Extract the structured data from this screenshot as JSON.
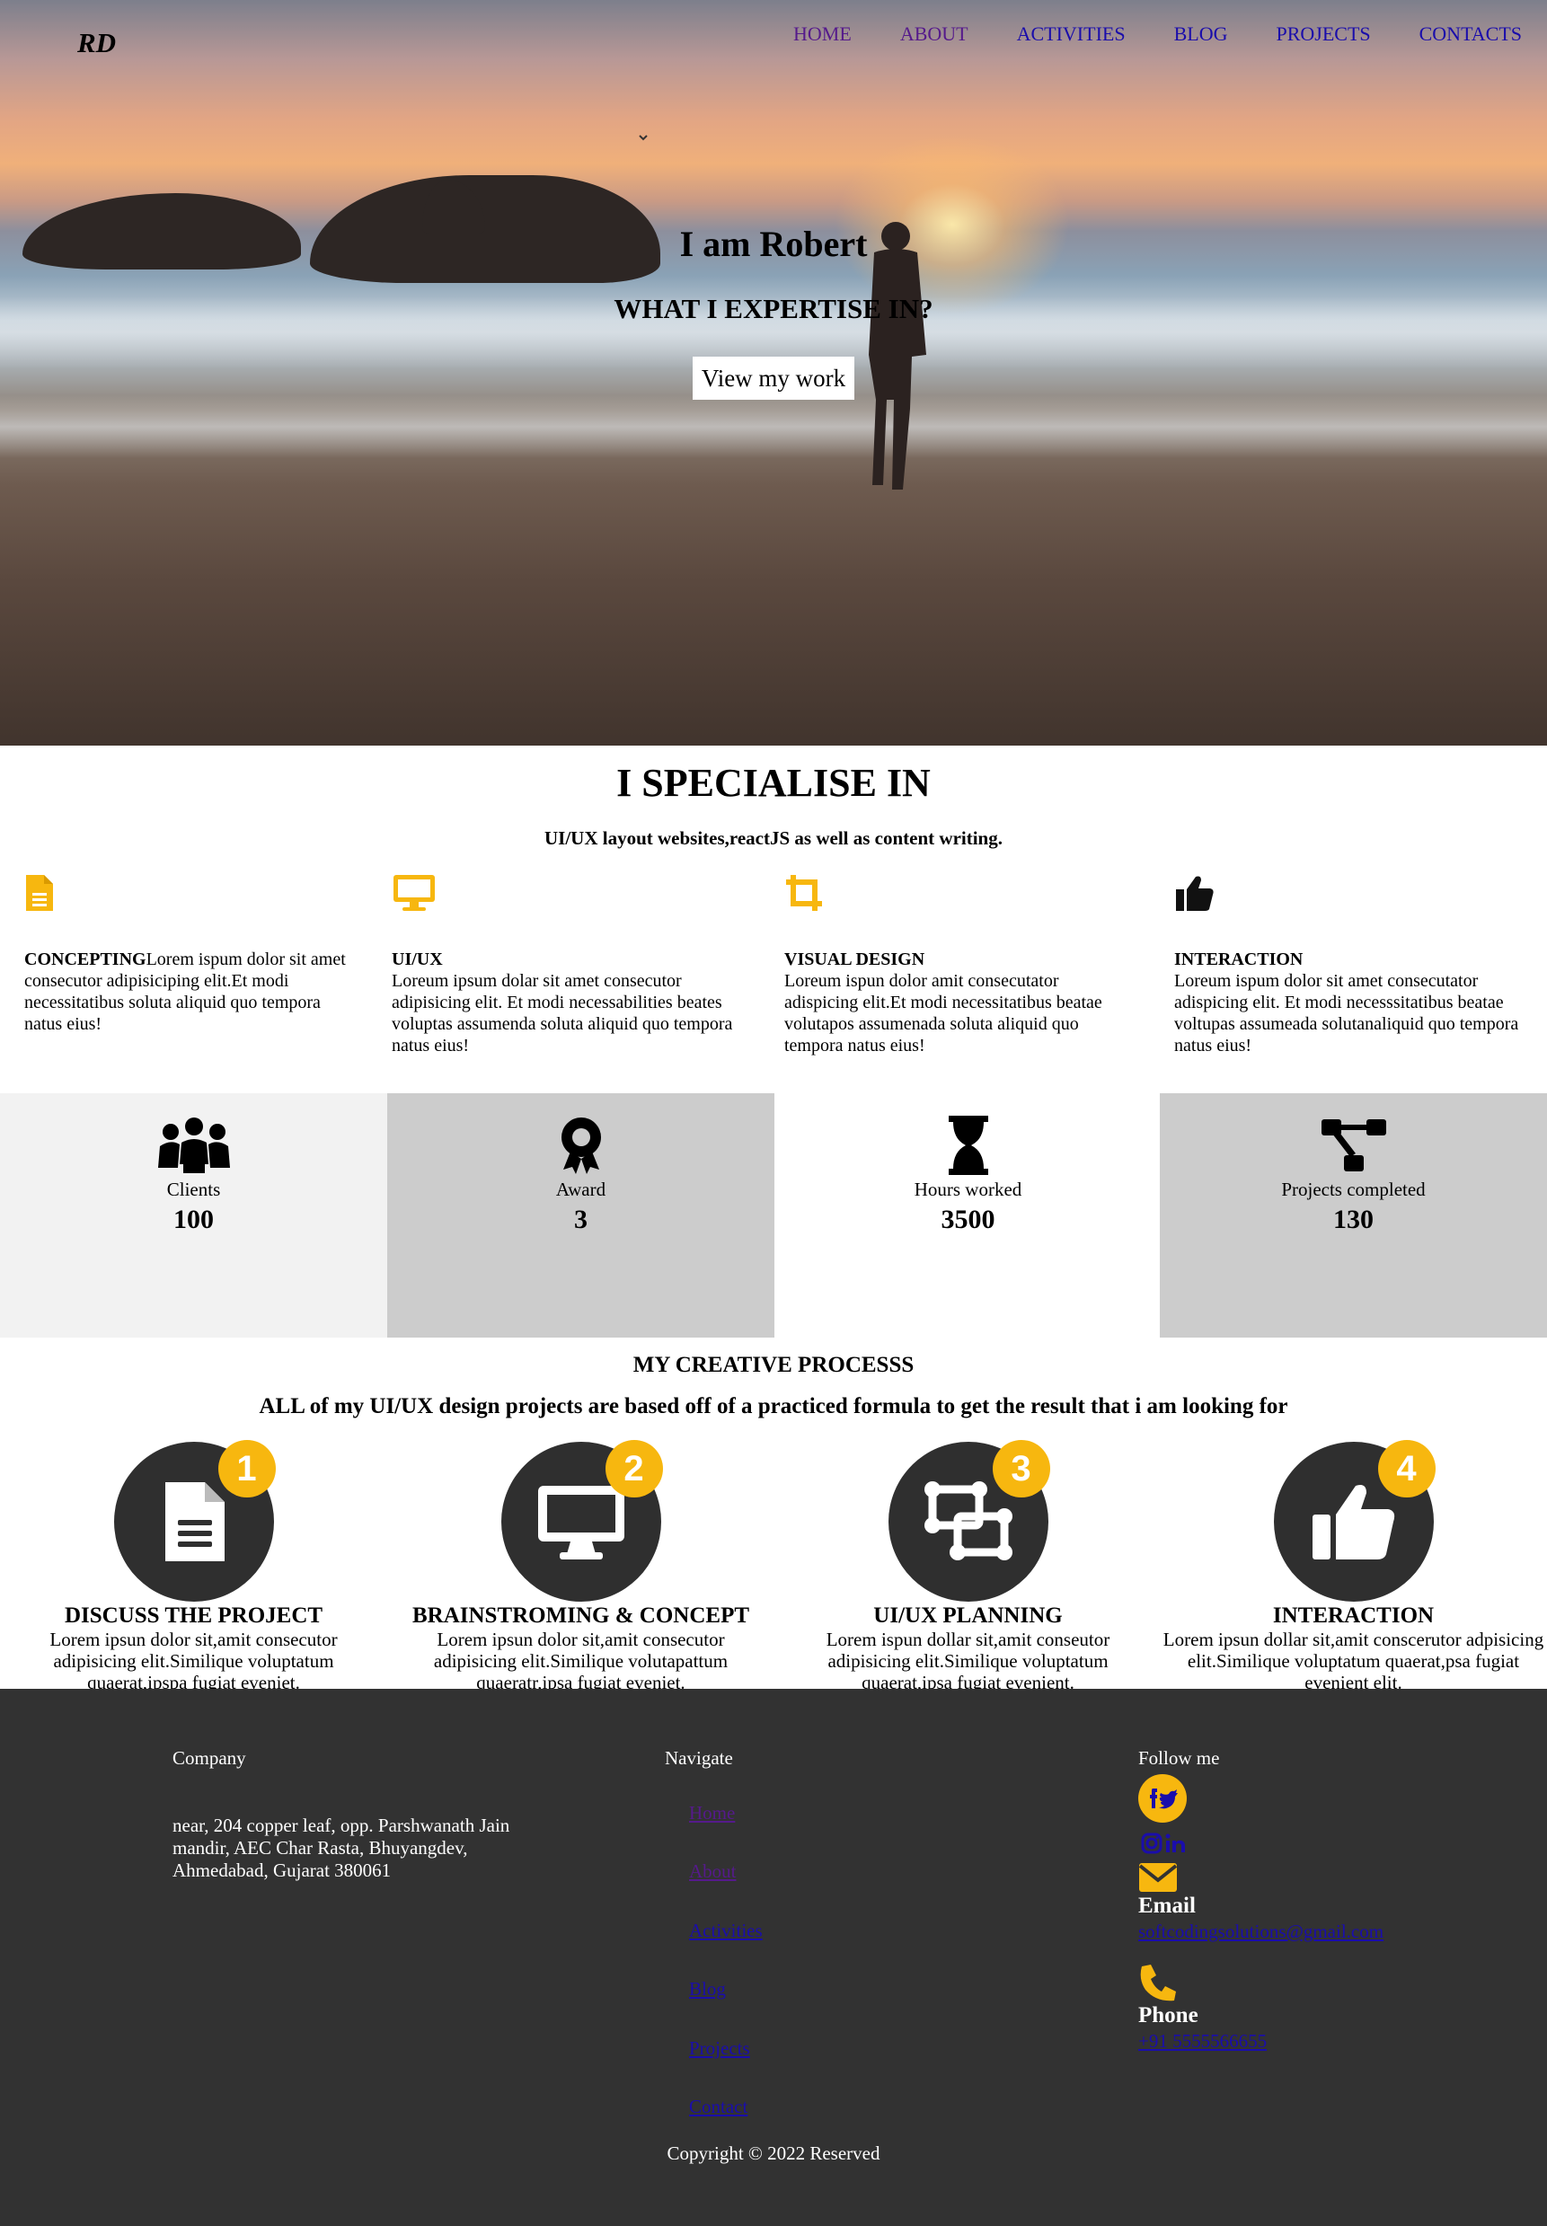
{
  "header": {
    "logo": "RD",
    "nav": [
      {
        "label": "HOME",
        "visited": true
      },
      {
        "label": "ABOUT",
        "visited": true
      },
      {
        "label": "ACTIVITIES",
        "visited": false
      },
      {
        "label": "BLOG",
        "visited": false
      },
      {
        "label": "PROJECTS",
        "visited": false
      },
      {
        "label": "CONTACTS",
        "visited": false
      }
    ]
  },
  "hero": {
    "title": "I am Robert",
    "subtitle": "WHAT I EXPERTISE IN?",
    "button": "View my work"
  },
  "specialise": {
    "title": "I SPECIALISE IN",
    "subtitle": "UI/UX layout websites,reactJS as well as content writing.",
    "items": [
      {
        "icon": "document-icon",
        "title": "CONCEPTING",
        "text": "Lorem ispum dolor sit amet consecutor adipisiciping elit.Et modi necessitatibus soluta aliquid quo tempora natus eius!"
      },
      {
        "icon": "monitor-icon",
        "title": "UI/UX",
        "text": "Loreum ipsum dolar sit amet consecutor adipisicing elit. Et modi necessabilities beates voluptas assumenda soluta aliquid quo tempora natus eius!"
      },
      {
        "icon": "crop-icon",
        "title": "VISUAL DESIGN",
        "text": "Loreum ispun dolor amit consecutator adispicing elit.Et modi necessitatibus beatae volutapos assumenada soluta aliquid quo tempora natus eius!"
      },
      {
        "icon": "thumbs-up-icon",
        "title": "INTERACTION",
        "text": "Loreum ispum dolor sit amet consecutator adispicing elit. Et modi necesssitatibus beatae voltupas assumeada solutanaliquid quo tempora natus eius!"
      }
    ]
  },
  "stats": [
    {
      "icon": "users-icon",
      "label": "Clients",
      "value": "100"
    },
    {
      "icon": "award-icon",
      "label": "Award",
      "value": "3"
    },
    {
      "icon": "hourglass-icon",
      "label": "Hours worked",
      "value": "3500"
    },
    {
      "icon": "project-diagram-icon",
      "label": "Projects completed",
      "value": "130"
    }
  ],
  "process": {
    "title": "MY CREATIVE PROCESSS",
    "subtitle": "ALL of my UI/UX design projects are based off of a practiced formula to get the result that i am looking for",
    "steps": [
      {
        "num": "1",
        "icon": "file-icon",
        "title": "DISCUSS THE PROJECT",
        "text": "Lorem ipsun dolor sit,amit consecutor adipisicing elit.Similique voluptatum quaerat,ipspa fugiat eveniet."
      },
      {
        "num": "2",
        "icon": "desktop-icon",
        "title": "BRAINSTROMING & CONCEPT",
        "text": "Lorem ipsun dolor sit,amit consecutor adipisicing elit.Similique volutapattum quaeratr,ipsa fugiat eveniet."
      },
      {
        "num": "3",
        "icon": "object-group-icon",
        "title": "UI/UX PLANNING",
        "text": "Lorem ispun dollar sit,amit conseutor adipisicing elit.Similique voluptatum quaerat,ipsa fugiat evenient."
      },
      {
        "num": "4",
        "icon": "thumbs-up-icon",
        "title": "INTERACTION",
        "text": "Lorem ipsun dollar sit,amit conscerutor adpisicing elit.Similique voluptatum quaerat,psa fugiat evenient elit."
      }
    ]
  },
  "footer": {
    "company_heading": "Company",
    "address": "near, 204 copper leaf, opp. Parshwanath Jain mandir, AEC Char Rasta, Bhuyangdev, Ahmedabad, Gujarat 380061",
    "navigate_heading": "Navigate",
    "links": [
      {
        "label": "Home",
        "visited": true
      },
      {
        "label": "About",
        "visited": true
      },
      {
        "label": "Activities",
        "visited": false
      },
      {
        "label": "Blog",
        "visited": false
      },
      {
        "label": "Projects",
        "visited": false
      },
      {
        "label": "Contact",
        "visited": false
      }
    ],
    "follow_heading": "Follow me",
    "email_label": "Email",
    "email": "softcodingsolutions@gmail.com",
    "phone_label": "Phone",
    "phone": "+91 5555566655",
    "copyright": "Copyright © 2022 Reserved"
  },
  "colors": {
    "accent": "#f7b70f",
    "dark": "#323232",
    "stat_light": "#f2f2f2",
    "stat_grey": "#cccccc",
    "link": "#1a0dab",
    "visited": "#551a8b"
  }
}
